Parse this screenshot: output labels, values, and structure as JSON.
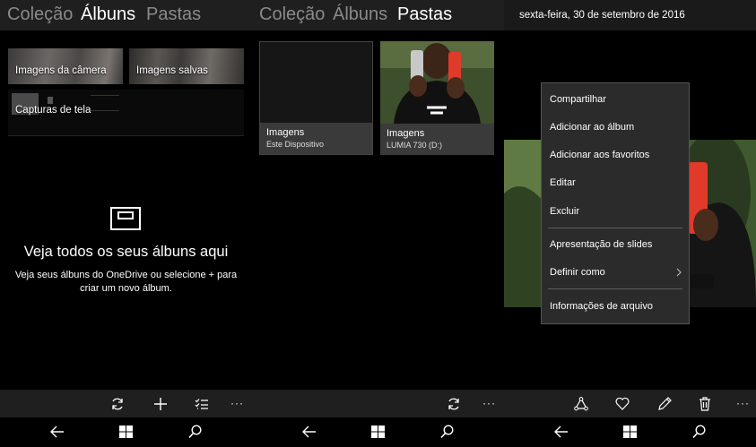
{
  "albums_view": {
    "pivots": [
      {
        "label": "Coleção"
      },
      {
        "label": "Álbuns"
      },
      {
        "label": "Pastas"
      }
    ],
    "tiles": [
      {
        "label": "Imagens da câmera"
      },
      {
        "label": "Imagens salvas"
      },
      {
        "label": "Capturas de tela"
      }
    ],
    "empty_title": "Veja todos os seus álbuns aqui",
    "empty_desc_line1": "Veja seus álbuns do OneDrive ou selecione + para",
    "empty_desc_line2": "criar um novo álbum.",
    "appbar": {
      "icons": [
        "sync-icon",
        "add-icon",
        "select-list-icon"
      ],
      "more_label": "···"
    }
  },
  "folders_view": {
    "pivots": [
      {
        "label": "Coleção"
      },
      {
        "label": "Álbuns"
      },
      {
        "label": "Pastas"
      }
    ],
    "folders": [
      {
        "name": "Imagens",
        "location": "Este Dispositivo"
      },
      {
        "name": "Imagens",
        "location": "LUMIA 730 (D:)"
      }
    ],
    "appbar": {
      "icons": [
        "sync-icon"
      ],
      "more_label": "···"
    }
  },
  "photo_view": {
    "date": "sexta-feira, 30 de setembro de 2016",
    "context_menu": [
      {
        "label": "Compartilhar"
      },
      {
        "label": "Adicionar ao álbum"
      },
      {
        "label": "Adicionar aos favoritos"
      },
      {
        "label": "Editar"
      },
      {
        "label": "Excluir"
      },
      {
        "label": "Apresentação de slides"
      },
      {
        "label": "Definir como",
        "submenu": true
      },
      {
        "label": "Informações de arquivo"
      }
    ],
    "appbar": {
      "icons": [
        "share-icon",
        "heart-icon",
        "edit-icon",
        "delete-icon"
      ],
      "more_label": "···"
    }
  },
  "navbar": {
    "icons": [
      "back-icon",
      "windows-icon",
      "search-icon"
    ]
  },
  "colors": {
    "header_bg": "#1f1f1f",
    "inactive_pivot": "#8a8a8a",
    "menu_bg": "#2b2b2b",
    "folder_footer": "#3a3a3a"
  }
}
